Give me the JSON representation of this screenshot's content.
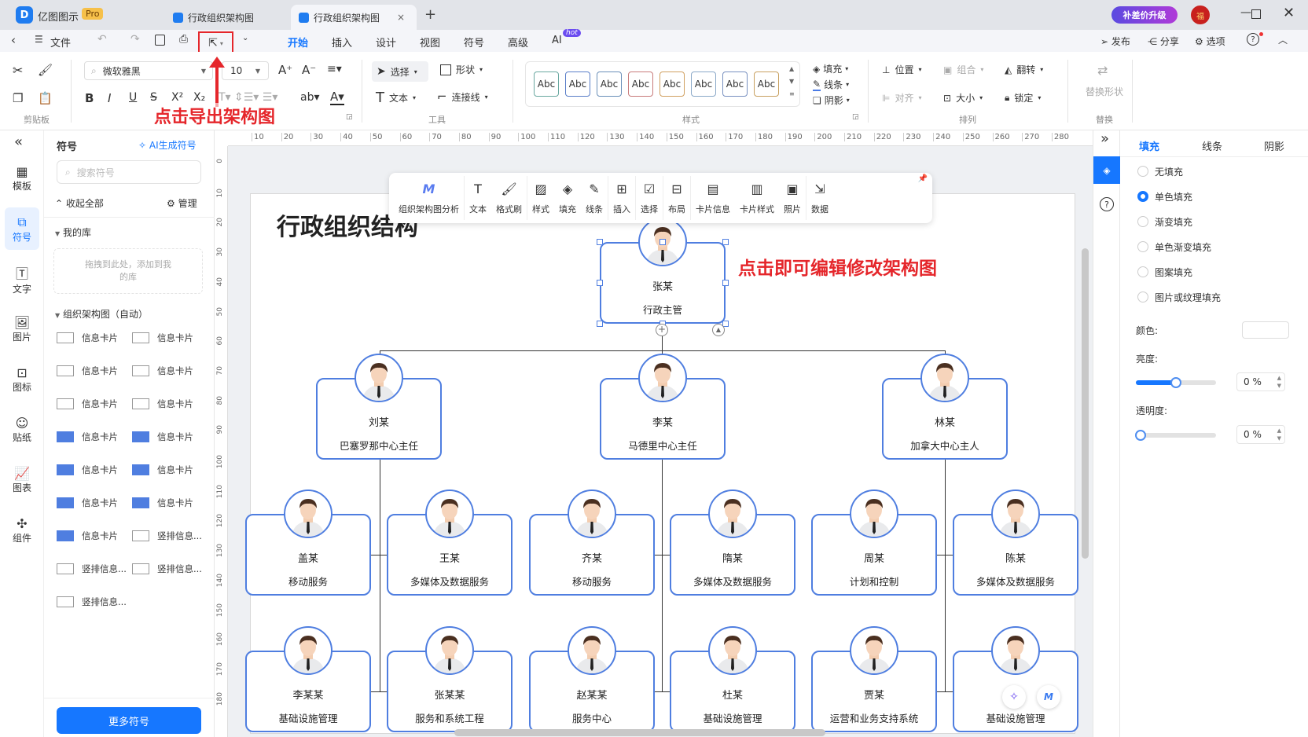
{
  "app": {
    "name": "亿图图示",
    "badge": "Pro",
    "tabs": [
      {
        "label": "行政组织架构图",
        "active": false
      },
      {
        "label": "行政组织架构图",
        "active": true
      }
    ],
    "promo": "补差价升级",
    "avatar_text": "福"
  },
  "menu": {
    "file": "文件",
    "tabs": [
      "开始",
      "插入",
      "设计",
      "视图",
      "符号",
      "高级",
      "AI"
    ],
    "active_tab": "开始",
    "ai_badge": "hot",
    "right": [
      "发布",
      "分享",
      "选项"
    ]
  },
  "ribbon": {
    "font_name": "微软雅黑",
    "font_size": "10",
    "groups": {
      "clipboard": "剪贴板",
      "tools": "工具",
      "styles": "样式",
      "arrange": "排列",
      "replace": "替换"
    },
    "tools": {
      "select": "选择",
      "shape": "形状",
      "text": "文本",
      "connector": "连接线"
    },
    "style_samples": [
      "Abc",
      "Abc",
      "Abc",
      "Abc",
      "Abc",
      "Abc",
      "Abc",
      "Abc"
    ],
    "style_colors": [
      "#6aa8a0",
      "#5a7ec8",
      "#6a8fb8",
      "#c87a7a",
      "#d0a060",
      "#8aa8c8",
      "#7890c0",
      "#c8a060"
    ],
    "fill": "填充",
    "line": "线条",
    "shadow": "阴影",
    "arrange": {
      "position": "位置",
      "group": "组合",
      "flip": "翻转",
      "align": "对齐",
      "size": "大小",
      "lock": "锁定"
    },
    "replace_shape": "替换形状"
  },
  "annotations": {
    "export_hint": "点击导出架构图",
    "edit_hint": "点击即可编辑修改架构图",
    "color": "#e5262b"
  },
  "rail": [
    {
      "label": "模板"
    },
    {
      "label": "符号",
      "active": true
    },
    {
      "label": "文字"
    },
    {
      "label": "图片"
    },
    {
      "label": "图标"
    },
    {
      "label": "贴纸"
    },
    {
      "label": "图表"
    },
    {
      "label": "组件"
    }
  ],
  "symbols": {
    "title": "符号",
    "ai_generate": "AI生成符号",
    "search_placeholder": "搜索符号",
    "collapse_all": "收起全部",
    "manage": "管理",
    "my_library": "我的库",
    "drop_hint": "拖拽到此处，添加到我的库",
    "org_section": "组织架构图（自动）",
    "items": [
      "信息卡片",
      "信息卡片",
      "信息卡片",
      "信息卡片",
      "信息卡片",
      "信息卡片",
      "信息卡片",
      "信息卡片",
      "信息卡片",
      "信息卡片",
      "信息卡片",
      "信息卡片",
      "信息卡片",
      "竖排信息...",
      "竖排信息...",
      "竖排信息...",
      "竖排信息..."
    ],
    "more": "更多符号"
  },
  "ruler": {
    "h": [
      "10",
      "20",
      "30",
      "40",
      "50",
      "60",
      "70",
      "80",
      "90",
      "100",
      "110",
      "120",
      "130",
      "140",
      "150",
      "160",
      "170",
      "180",
      "190",
      "200",
      "210",
      "220",
      "230",
      "240",
      "250",
      "260",
      "270",
      "280"
    ],
    "v": [
      "0",
      "10",
      "20",
      "30",
      "40",
      "50",
      "60",
      "70",
      "80",
      "90",
      "100",
      "110",
      "120",
      "130",
      "140",
      "150",
      "160",
      "170",
      "180"
    ]
  },
  "float_toolbar": [
    "组织架构图分析",
    "文本",
    "格式刷",
    "样式",
    "填充",
    "线条",
    "插入",
    "选择",
    "布局",
    "卡片信息",
    "卡片样式",
    "照片",
    "数据"
  ],
  "chart": {
    "title": "行政组织结构",
    "root": {
      "name": "张某",
      "title": "行政主管"
    },
    "level2": [
      {
        "name": "刘某",
        "title": "巴塞罗那中心主任"
      },
      {
        "name": "李某",
        "title": "马德里中心主任"
      },
      {
        "name": "林某",
        "title": "加拿大中心主人"
      }
    ],
    "row1": [
      {
        "name": "盖某",
        "title": "移动服务"
      },
      {
        "name": "王某",
        "title": "多媒体及数据服务"
      },
      {
        "name": "齐某",
        "title": "移动服务"
      },
      {
        "name": "隋某",
        "title": "多媒体及数据服务"
      },
      {
        "name": "周某",
        "title": "计划和控制"
      },
      {
        "name": "陈某",
        "title": "多媒体及数据服务"
      }
    ],
    "row2": [
      {
        "name": "李某某",
        "title": "基础设施管理"
      },
      {
        "name": "张某某",
        "title": "服务和系统工程"
      },
      {
        "name": "赵某某",
        "title": "服务中心"
      },
      {
        "name": "杜某",
        "title": "基础设施管理"
      },
      {
        "name": "贾某",
        "title": "运营和业务支持系统"
      },
      {
        "name": "",
        "title": "基础设施管理"
      }
    ]
  },
  "right_panel": {
    "tabs": [
      "填充",
      "线条",
      "阴影"
    ],
    "active_tab": "填充",
    "fill_options": [
      "无填充",
      "单色填充",
      "渐变填充",
      "单色渐变填充",
      "图案填充",
      "图片或纹理填充"
    ],
    "selected": "单色填充",
    "color_label": "颜色:",
    "brightness_label": "亮度:",
    "brightness_value": "0 %",
    "brightness_level": 0.5,
    "opacity_label": "透明度:",
    "opacity_value": "0 %",
    "opacity_level": 0
  }
}
